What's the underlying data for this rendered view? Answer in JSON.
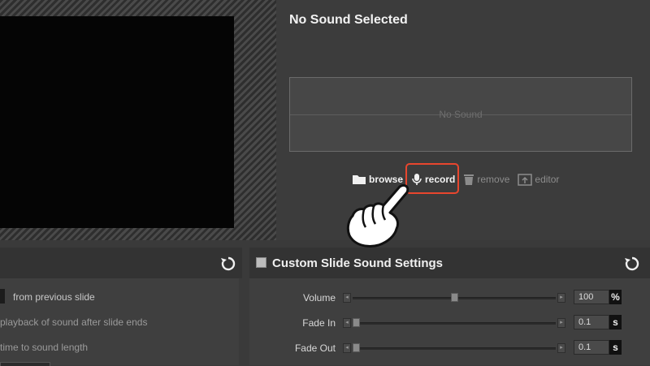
{
  "sound_panel": {
    "title": "No Sound Selected",
    "waveform_label": "No Sound",
    "actions": [
      {
        "label": "browse",
        "icon": "folder-icon"
      },
      {
        "label": "record",
        "icon": "microphone-icon"
      },
      {
        "label": "remove",
        "icon": "trash-icon"
      },
      {
        "label": "editor",
        "icon": "editor-icon"
      }
    ],
    "highlight_color": "#e8462e"
  },
  "slide_sound": {
    "rows": [
      "from previous slide",
      "playback of sound after slide ends",
      " time to sound length"
    ]
  },
  "custom_settings": {
    "title": "Custom Slide Sound Settings",
    "checked": false,
    "sliders": [
      {
        "label": "Volume",
        "value": "100",
        "unit": "%",
        "level": 0.5
      },
      {
        "label": "Fade In",
        "value": "0.1",
        "unit": "s",
        "level": 0.0
      },
      {
        "label": "Fade Out",
        "value": "0.1",
        "unit": "s",
        "level": 0.0
      }
    ]
  }
}
